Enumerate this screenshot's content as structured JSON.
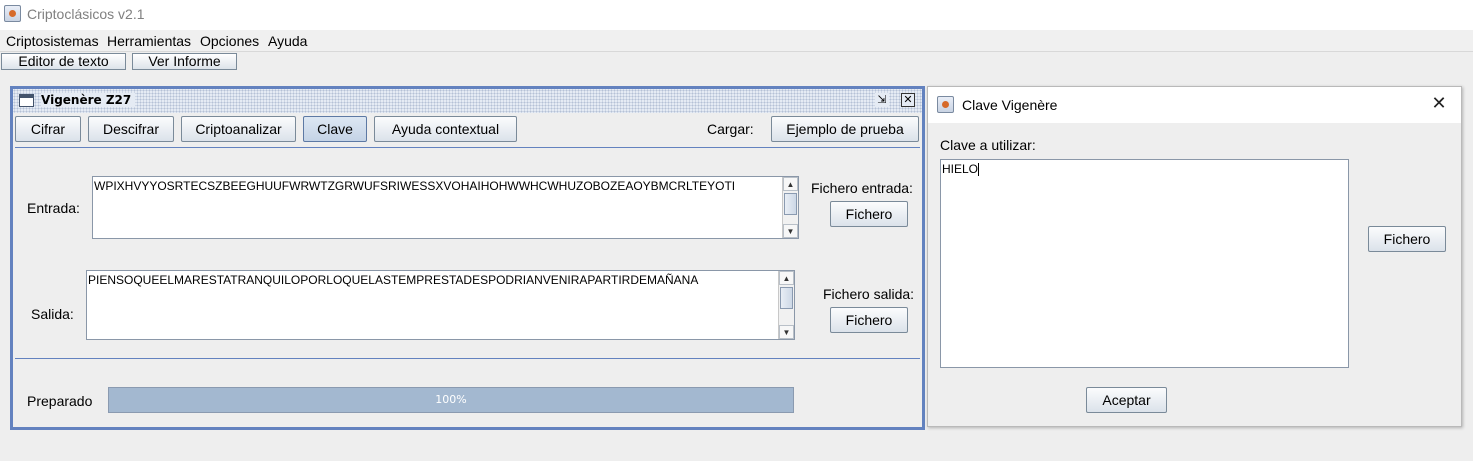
{
  "app": {
    "title": "Criptoclásicos v2.1"
  },
  "menubar": {
    "items": [
      "Criptosistemas",
      "Herramientas",
      "Opciones",
      "Ayuda"
    ]
  },
  "toolbar": {
    "editor_label": "Editor de texto",
    "report_label": "Ver Informe"
  },
  "frame": {
    "title": "Vigenère Z27",
    "buttons": {
      "cifrar": "Cifrar",
      "descifrar": "Descifrar",
      "criptoanalizar": "Criptoanalizar",
      "clave": "Clave",
      "ayuda": "Ayuda contextual"
    },
    "cargar_label": "Cargar:",
    "ejemplo_label": "Ejemplo de prueba",
    "entrada": {
      "label": "Entrada:",
      "text": "WPIXHVYYOSRTECSZBEEGHUUFWRWTZGRWUFSRIWESSXVOHAIHOHWWHCWHUZOBOZEAOYBMCRLTEYOTI",
      "file_label": "Fichero entrada:",
      "file_button": "Fichero"
    },
    "salida": {
      "label": "Salida:",
      "text": "PIENSOQUEELMARESTATRANQUILOPORLOQUELASTEMPRESTADESPODRIANVENIRAPARTIRDEMAÑANA",
      "file_label": "Fichero salida:",
      "file_button": "Fichero"
    },
    "status": {
      "label": "Preparado",
      "progress": 1.0,
      "progress_text": "100%"
    }
  },
  "dialog": {
    "title": "Clave Vigenère",
    "key_label": "Clave a utilizar:",
    "key_value": "HIELO",
    "file_button": "Fichero",
    "accept_button": "Aceptar"
  },
  "colors": {
    "frame_border": "#6382bf",
    "progress_fill": "#a3b8d0"
  }
}
